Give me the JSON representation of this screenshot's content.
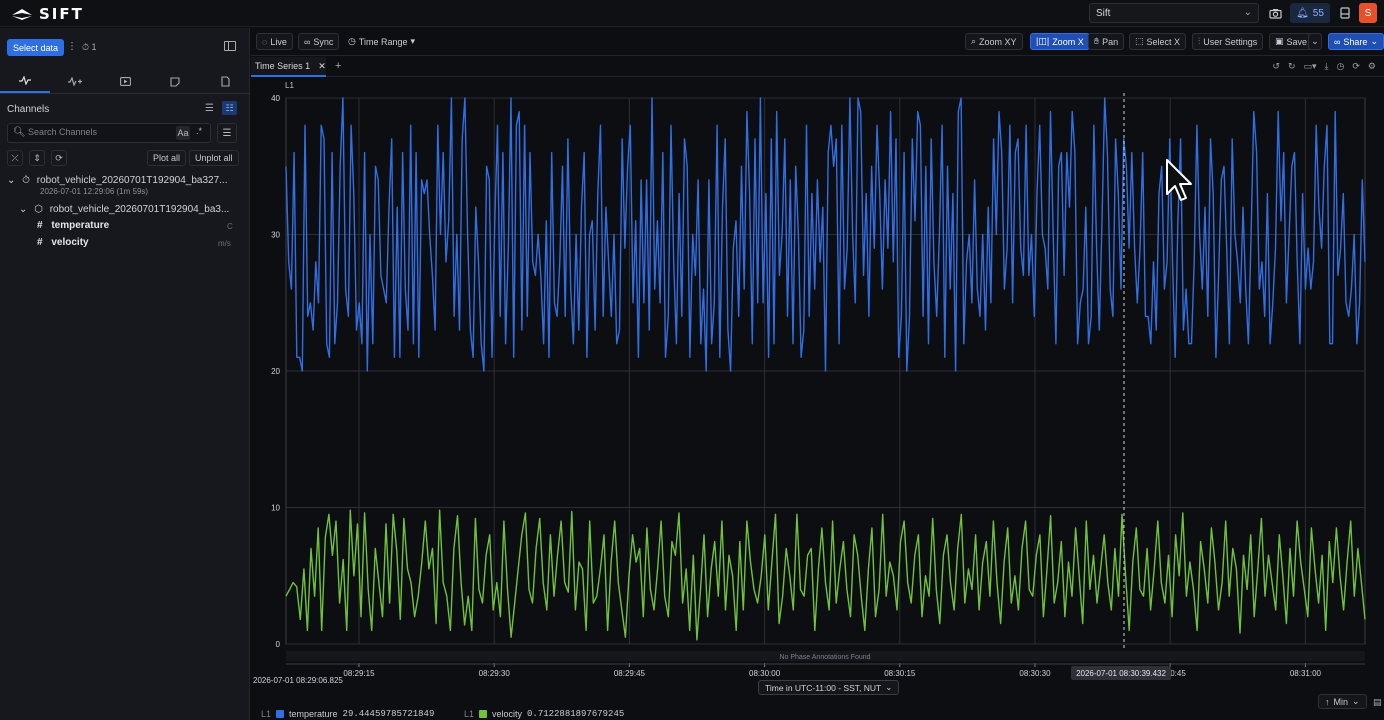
{
  "app": {
    "logo_text": "SIFT",
    "org": "Sift",
    "notifications": "55",
    "avatar_initial": "S"
  },
  "sidebar": {
    "select_data_label": "Select data",
    "run_count": "1",
    "channels_title": "Channels",
    "search_placeholder": "Search Channels",
    "case_toggle": "Aa",
    "regex_toggle": ".*",
    "plot_all": "Plot all",
    "unplot_all": "Unplot all",
    "run": {
      "name": "robot_vehicle_20260701T192904_ba327...",
      "subtitle": "2026-07-01 12:29:06 (1m 59s)"
    },
    "asset": {
      "name": "robot_vehicle_20260701T192904_ba3..."
    },
    "channels": [
      {
        "name": "temperature",
        "unit": "C"
      },
      {
        "name": "velocity",
        "unit": "m/s"
      }
    ]
  },
  "toolbar": {
    "live": "Live",
    "sync": "Sync",
    "time_range": "Time Range",
    "zoom_xy": "Zoom XY",
    "zoom_x": "Zoom X",
    "pan": "Pan",
    "select_x": "Select X",
    "user_settings": "User Settings",
    "save": "Save",
    "share": "Share"
  },
  "tabs": [
    {
      "label": "Time Series 1"
    }
  ],
  "chart": {
    "axis_label": "L1",
    "start_time": "2026-07-01 08:29:06.825",
    "cursor_time": "2026-07-01 08:30:39.432",
    "phase_note": "No Phase Annotations Found",
    "timezone": "Time in UTC-11:00 - SST, NUT",
    "min_label": "Min"
  },
  "legend": [
    {
      "axis": "L1",
      "name": "temperature",
      "value": "29.44459785721849",
      "color": "#2f6fe4"
    },
    {
      "axis": "L1",
      "name": "velocity",
      "value": "0.712288189767924​5",
      "color": "#6fc23a"
    }
  ],
  "chart_data": {
    "type": "line",
    "ylim": [
      0,
      40
    ],
    "y_ticks": [
      0,
      10,
      20,
      30,
      40
    ],
    "x_ticks": [
      "08:29:15",
      "08:29:30",
      "08:29:45",
      "08:30:00",
      "08:30:15",
      "08:30:30",
      "08:30:45",
      "08:31:00"
    ],
    "x_range_seconds": [
      0,
      119
    ],
    "series": [
      {
        "name": "temperature",
        "color": "#2f6fe4",
        "values": [
          35,
          28,
          26,
          36,
          21,
          21,
          20,
          38,
          24,
          25,
          23,
          28,
          25,
          38,
          37,
          22,
          21,
          36,
          22,
          25,
          35,
          40,
          26,
          24,
          38,
          33,
          23,
          25,
          22,
          36,
          20,
          30,
          22,
          35,
          34,
          27,
          26,
          25,
          32,
          37,
          21,
          32,
          21,
          36,
          26,
          23,
          38,
          22,
          36,
          21,
          34,
          33,
          34,
          30,
          27,
          23,
          38,
          30,
          36,
          28,
          31,
          40,
          24,
          30,
          23,
          37,
          40,
          30,
          23,
          21,
          32,
          28,
          22,
          20,
          35,
          34,
          21,
          31,
          38,
          24,
          36,
          22,
          29,
          40,
          21,
          38,
          39,
          23,
          38,
          24,
          36,
          28,
          27,
          30,
          27,
          22,
          31,
          21,
          36,
          25,
          24,
          28,
          35,
          24,
          37,
          26,
          22,
          30,
          23,
          32,
          36,
          21,
          30,
          31,
          23,
          33,
          38,
          24,
          32,
          28,
          24,
          30,
          22,
          23,
          37,
          29,
          35,
          38,
          25,
          31,
          21,
          34,
          25,
          34,
          23,
          40,
          26,
          31,
          25,
          36,
          21,
          24,
          38,
          28,
          22,
          33,
          24,
          37,
          35,
          21,
          30,
          27,
          34,
          22,
          26,
          20,
          34,
          22,
          25,
          38,
          21,
          32,
          37,
          23,
          20,
          29,
          31,
          24,
          35,
          26,
          39,
          33,
          22,
          37,
          25,
          40,
          25,
          33,
          21,
          37,
          22,
          39,
          27,
          30,
          37,
          24,
          34,
          22,
          35,
          30,
          21,
          23,
          38,
          24,
          33,
          26,
          34,
          28,
          32,
          20,
          36,
          38,
          35,
          37,
          22,
          38,
          26,
          29,
          40,
          30,
          25,
          40,
          39,
          27,
          33,
          24,
          35,
          29,
          38,
          33,
          26,
          34,
          29,
          39,
          28,
          37,
          21,
          24,
          36,
          20,
          24,
          37,
          31,
          39,
          38,
          24,
          35,
          22,
          37,
          28,
          24,
          30,
          38,
          21,
          35,
          26,
          33,
          20,
          39,
          40,
          22,
          28,
          30,
          25,
          34,
          26,
          24,
          30,
          23,
          32,
          25,
          37,
          30,
          39,
          36,
          26,
          29,
          38,
          25,
          36,
          37,
          29,
          27,
          38,
          27,
          30,
          24,
          33,
          38,
          30,
          29,
          26,
          39,
          30,
          22,
          35,
          36,
          27,
          36,
          32,
          39,
          36,
          22,
          25,
          26,
          32,
          22,
          24,
          38,
          29,
          23,
          31,
          40,
          36,
          26,
          24,
          37,
          33,
          26,
          37,
          35,
          29,
          36,
          29,
          25,
          29,
          36,
          24,
          24,
          22,
          28,
          23,
          33,
          35,
          26,
          28,
          37,
          28,
          21,
          31,
          37,
          23,
          26,
          22,
          22,
          28,
          38,
          30,
          26,
          32,
          24,
          37,
          33,
          21,
          27,
          34,
          35,
          29,
          22,
          37,
          30,
          28,
          25,
          32,
          26,
          22,
          30,
          39,
          36,
          26,
          28,
          24,
          33,
          22,
          25,
          29,
          39,
          31,
          36,
          25,
          30,
          35,
          36,
          28,
          22,
          33,
          26,
          29,
          26,
          28,
          38,
          32,
          29,
          35,
          38,
          22,
          22,
          39,
          27,
          29,
          33,
          25,
          24,
          26,
          30,
          22,
          25,
          34,
          28
        ]
      },
      {
        "name": "velocity",
        "color": "#6fc23a",
        "values": [
          3.5,
          4.0,
          4.5,
          4.2,
          1.8,
          5.5,
          1.0,
          7.0,
          3.5,
          8.5,
          1.0,
          7.8,
          9.5,
          6.5,
          9.0,
          3.0,
          6.2,
          1.0,
          9.8,
          5.0,
          8.8,
          2.0,
          9.6,
          4.0,
          1.0,
          7.0,
          4.5,
          2.0,
          8.8,
          3.0,
          9.5,
          6.8,
          1.8,
          9.2,
          5.5,
          4.5,
          2.0,
          3.5,
          6.0,
          9.0,
          5.5,
          7.0,
          1.5,
          9.8,
          4.5,
          3.5,
          1.0,
          7.0,
          9.4,
          4.5,
          1.4,
          3.5,
          1.0,
          9.2,
          4.0,
          3.0,
          6.5,
          8.0,
          2.5,
          4.5,
          2.0,
          9.0,
          4.0,
          0.5,
          3.0,
          5.5,
          8.0,
          9.6,
          4.0,
          3.0,
          7.0,
          9.2,
          4.5,
          2.5,
          8.0,
          3.5,
          6.5,
          9.0,
          4.5,
          3.8,
          9.7,
          2.5,
          6.0,
          5.5,
          1.0,
          9.0,
          3.0,
          3.5,
          5.5,
          8.0,
          1.0,
          6.0,
          9.0,
          4.5,
          2.5,
          0.5,
          5.0,
          8.0,
          6.0,
          7.0,
          2.0,
          8.5,
          4.0,
          2.5,
          5.5,
          9.0,
          3.5,
          2.0,
          7.5,
          6.5,
          9.6,
          3.0,
          5.5,
          1.0,
          6.5,
          0.3,
          4.0,
          8.0,
          2.0,
          5.5,
          7.5,
          3.5,
          9.0,
          2.5,
          6.5,
          5.0,
          1.0,
          7.5,
          2.5,
          9.0,
          6.0,
          4.0,
          3.0,
          5.0,
          8.0,
          2.5,
          6.0,
          9.5,
          1.5,
          3.5,
          7.0,
          5.0,
          2.5,
          9.5,
          4.0,
          3.5,
          6.5,
          7.0,
          1.0,
          5.5,
          8.5,
          4.5,
          2.5,
          9.0,
          3.0,
          5.5,
          7.5,
          4.0,
          2.0,
          8.0,
          6.5,
          3.5,
          1.0,
          5.5,
          8.5,
          2.0,
          4.0,
          9.5,
          3.5,
          6.0,
          5.0,
          2.5,
          7.5,
          9.0,
          4.5,
          3.0,
          6.5,
          8.0,
          2.0,
          5.0,
          3.5,
          9.2,
          4.0,
          1.5,
          6.5,
          8.0,
          4.5,
          2.5,
          7.0,
          9.5,
          3.0,
          5.5,
          4.0,
          8.0,
          2.5,
          6.0,
          7.5,
          3.5,
          9.0,
          4.5,
          1.5,
          6.0,
          8.5,
          3.0,
          5.0,
          2.5,
          7.0,
          9.0,
          4.0,
          3.5,
          6.5,
          8.0,
          2.0,
          5.5,
          9.4,
          3.0,
          4.5,
          7.5,
          2.0,
          6.0,
          3.5,
          8.5,
          5.0,
          1.5,
          9.0,
          4.0,
          6.5,
          3.0,
          5.5,
          8.0,
          4.5,
          2.5,
          7.0,
          3.5,
          9.5,
          5.0,
          1.0,
          6.0,
          8.5,
          4.0,
          3.5,
          7.0,
          2.5,
          5.5,
          9.0,
          4.5,
          3.0,
          6.5,
          2.0,
          8.0,
          5.0,
          9.6,
          3.5,
          6.0,
          4.0,
          1.0,
          7.5,
          5.5,
          3.0,
          8.5,
          6.0,
          2.5,
          4.5,
          9.0,
          3.5,
          7.0,
          5.5,
          0.8,
          6.5,
          4.0,
          8.0,
          2.0,
          5.5,
          9.2,
          3.5,
          6.5,
          4.5,
          2.5,
          8.0,
          5.0,
          1.5,
          7.0,
          3.5,
          9.0,
          6.0,
          4.0,
          2.0,
          8.5,
          5.5,
          3.0,
          6.5,
          1.0,
          7.5,
          4.5,
          8.5,
          5.0,
          2.5,
          6.0,
          9.0,
          3.5,
          7.0,
          4.5,
          1.8
        ]
      }
    ]
  }
}
